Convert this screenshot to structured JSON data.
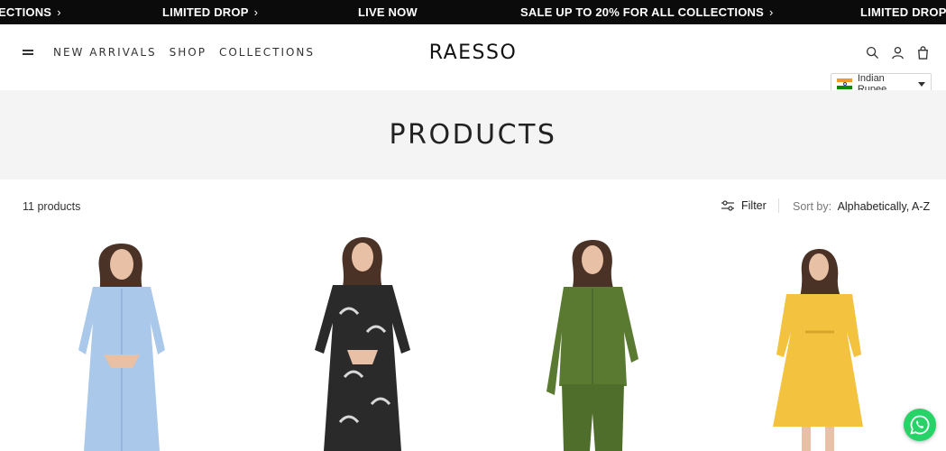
{
  "announcement": {
    "items": [
      {
        "text": "ECTIONS",
        "has_chevron": true
      },
      {
        "text": "LIMITED DROP",
        "has_chevron": true
      },
      {
        "text": "LIVE NOW",
        "has_chevron": false
      },
      {
        "text": "SALE UP TO 20% FOR ALL COLLECTIONS",
        "has_chevron": true
      },
      {
        "text": "LIMITED DROP",
        "has_chevron": false
      }
    ],
    "chevron": "›"
  },
  "header": {
    "menu_icon": "hamburger-icon",
    "nav": [
      "NEW ARRIVALS",
      "SHOP",
      "COLLECTIONS"
    ],
    "logo": "RAESSO",
    "icons": [
      "search-icon",
      "account-icon",
      "cart-icon"
    ],
    "currency": {
      "label": "Indian Rupee",
      "flag": "india-flag-icon"
    }
  },
  "hero": {
    "title": "PRODUCTS"
  },
  "toolbar": {
    "count": "11 products",
    "filter_label": "Filter",
    "sort_label": "Sort by:",
    "sort_value": "Alphabetically, A-Z"
  },
  "products": [
    {
      "name": "light-blue-shirt-dress",
      "color": "#a9c8ea"
    },
    {
      "name": "black-leaf-print-dress",
      "color": "#2a2a2a"
    },
    {
      "name": "olive-green-co-ord-set",
      "color": "#5a7a32"
    },
    {
      "name": "yellow-mini-dress",
      "color": "#f3c23e"
    }
  ],
  "floating": {
    "icon": "whatsapp-icon"
  },
  "colors": {
    "accent": "#0b0b0b",
    "hero_bg": "#f4f4f4",
    "whatsapp": "#25d366"
  }
}
